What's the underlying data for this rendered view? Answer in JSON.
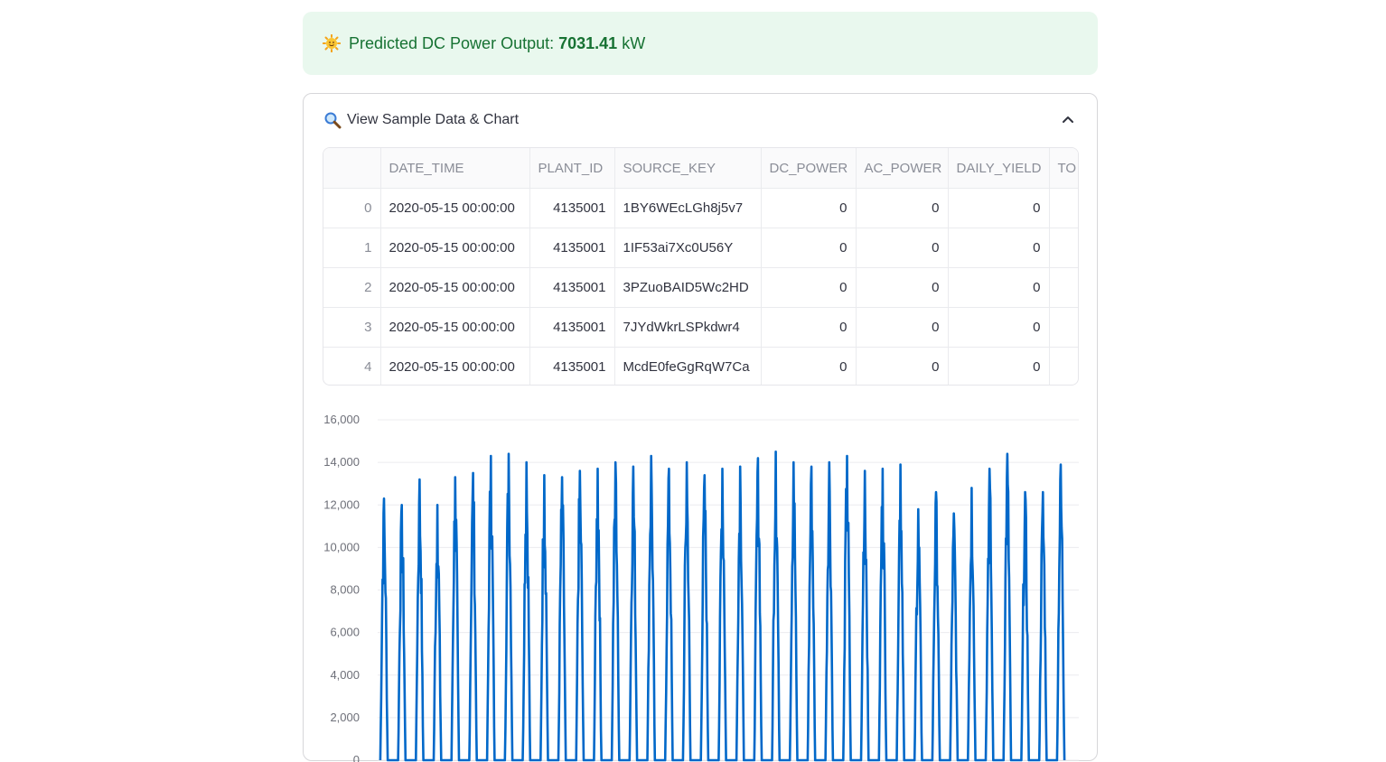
{
  "alert": {
    "icon": "sun-with-face-icon",
    "label": "Predicted DC Power Output:",
    "value": "7031.41",
    "unit": "kW"
  },
  "expander": {
    "icon": "magnifier-icon",
    "title": "View Sample Data & Chart"
  },
  "table": {
    "columns": [
      "",
      "DATE_TIME",
      "PLANT_ID",
      "SOURCE_KEY",
      "DC_POWER",
      "AC_POWER",
      "DAILY_YIELD",
      "TO"
    ],
    "rows": [
      [
        "0",
        "2020-05-15 00:00:00",
        "4135001",
        "1BY6WEcLGh8j5v7",
        "0",
        "0",
        "0"
      ],
      [
        "1",
        "2020-05-15 00:00:00",
        "4135001",
        "1IF53ai7Xc0U56Y",
        "0",
        "0",
        "0"
      ],
      [
        "2",
        "2020-05-15 00:00:00",
        "4135001",
        "3PZuoBAID5Wc2HD",
        "0",
        "0",
        "0"
      ],
      [
        "3",
        "2020-05-15 00:00:00",
        "4135001",
        "7JYdWkrLSPkdwr4",
        "0",
        "0",
        "0"
      ],
      [
        "4",
        "2020-05-15 00:00:00",
        "4135001",
        "McdE0feGgRqW7Ca",
        "0",
        "0",
        "0"
      ]
    ]
  },
  "chart_data": {
    "type": "line",
    "title": "",
    "xlabel": "",
    "ylabel": "",
    "ylim": [
      0,
      16000
    ],
    "yticks": [
      "0",
      "2,000",
      "4,000",
      "6,000",
      "8,000",
      "10,000",
      "12,000",
      "14,000",
      "16,000"
    ],
    "grid": true,
    "color": "#0068c9",
    "series": [
      {
        "daily_peaks": [
          12300,
          12000,
          13200,
          12000,
          13300,
          13500,
          14300,
          14400,
          14000,
          13400,
          13300,
          13600,
          13700,
          14000,
          13800,
          14300,
          13700,
          14000,
          13400,
          13700,
          13800,
          14200,
          14500,
          14000,
          13800,
          14000,
          14300,
          13600,
          13700,
          13900,
          11800,
          12600,
          11600,
          12800,
          13700,
          14400,
          12600,
          12600,
          13900
        ]
      }
    ]
  }
}
